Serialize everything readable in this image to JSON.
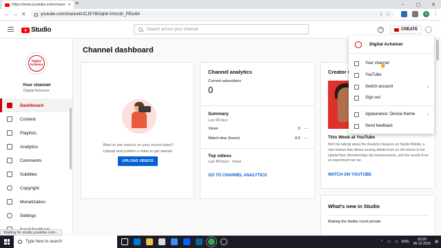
{
  "browser": {
    "tab_title": "https://www.youtube.com/chann",
    "url": "youtube.com/channel/UCJEYBiSqh8-Vmm1h_PEtu9A",
    "profile_initial": "G"
  },
  "header": {
    "logo_text": "Studio",
    "search_placeholder": "Search across your channel",
    "help_label": "?",
    "create_label": "CREATE"
  },
  "sidebar": {
    "avatar_line1": "Digital",
    "avatar_line2": "Acheiver",
    "channel_title": "Your channel",
    "channel_name": "Digital Acheiver",
    "items": [
      {
        "label": "Dashboard"
      },
      {
        "label": "Content"
      },
      {
        "label": "Playlists"
      },
      {
        "label": "Analytics"
      },
      {
        "label": "Comments"
      },
      {
        "label": "Subtitles"
      },
      {
        "label": "Copyright"
      },
      {
        "label": "Monetization"
      },
      {
        "label": "Settings"
      },
      {
        "label": "Send feedback"
      }
    ]
  },
  "main": {
    "page_title": "Channel dashboard",
    "upload_card": {
      "message_line1": "Want to see metrics on your recent video?",
      "message_line2": "Upload and publish a video to get started.",
      "button_label": "UPLOAD VIDEOS"
    },
    "analytics_card": {
      "title": "Channel analytics",
      "subscribers_label": "Current subscribers",
      "subscribers_value": "0",
      "summary_title": "Summary",
      "summary_period": "Last 28 days",
      "metrics": [
        {
          "label": "Views",
          "value": "0",
          "delta": "—"
        },
        {
          "label": "Watch time (hours)",
          "value": "0.0",
          "delta": "—"
        }
      ],
      "top_videos_title": "Top videos",
      "top_videos_period": "Last 48 hours · Views",
      "link_label": "GO TO CHANNEL ANALYTICS"
    },
    "insider_card": {
      "title": "Creator In",
      "headline": "This Week at YouTube",
      "body": "We'll be talking about the Analytics features on Studio Mobile, a new feature that allows reusing details from an old videos in the upload flow, Memberships tab improvements, and the results from an experiment we ran",
      "link_label": "WATCH ON YOUTUBE"
    },
    "news_card": {
      "title": "What's new in Studio",
      "item": "Making the dislike count private"
    }
  },
  "account_menu": {
    "name": "Digital Acheiver",
    "items": [
      {
        "label": "Your channel"
      },
      {
        "label": "YouTube"
      },
      {
        "label": "Switch account"
      },
      {
        "label": "Sign out"
      },
      {
        "label": "Appearance: Device theme"
      },
      {
        "label": "Send feedback"
      }
    ]
  },
  "status_bar": {
    "text": "Waiting for studio.youtube.com..."
  },
  "taskbar": {
    "search_placeholder": "Type here to search",
    "language": "ENG",
    "time": "03:20",
    "date": "06-12-2021"
  },
  "colors": {
    "brand_red": "#ff0000",
    "studio_red": "#cc0000",
    "link_blue": "#065fd4"
  }
}
